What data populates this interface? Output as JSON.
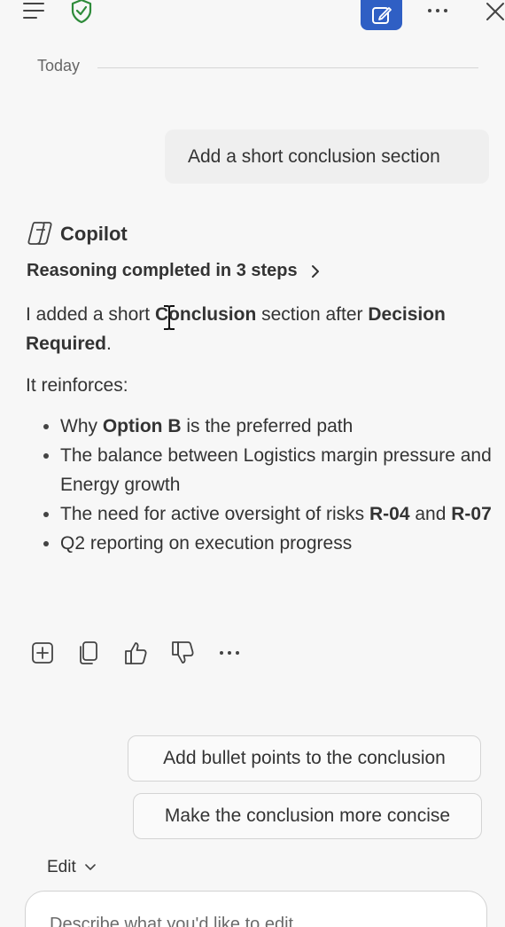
{
  "topbar": {
    "icons": [
      "hamburger-icon",
      "shield-check-icon",
      "compose-icon",
      "more-icon",
      "close-icon"
    ],
    "accent": "#2f5fc4",
    "shield_color": "#2e8b3a"
  },
  "chat": {
    "date_divider": "Today",
    "user_message": "Add a short conclusion section",
    "assistant": {
      "name": "Copilot",
      "reasoning": "Reasoning completed in 3 steps",
      "p1": {
        "a": "I added a short ",
        "b": "Conclusion",
        "c": " section after ",
        "d": "Decision Required",
        "e": "."
      },
      "p2": "It reinforces:",
      "bullets": {
        "b1": {
          "a": "Why ",
          "b": "Option B",
          "c": " is the preferred path"
        },
        "b2": {
          "a": "The balance between Logistics margin pressure and Energy growth"
        },
        "b3": {
          "a": "The need for active oversight of risks ",
          "b": "R-04",
          "c": " and ",
          "d": "R-07"
        },
        "b4": {
          "a": "Q2 reporting on execution progress"
        }
      }
    },
    "actions": [
      "add-icon",
      "copy-icon",
      "thumbs-up-icon",
      "thumbs-down-icon",
      "more-icon"
    ]
  },
  "suggestions": [
    "Add bullet points to the conclusion",
    "Make the conclusion more concise"
  ],
  "composer": {
    "mode": "Edit",
    "placeholder": "Describe what you'd like to edit"
  }
}
